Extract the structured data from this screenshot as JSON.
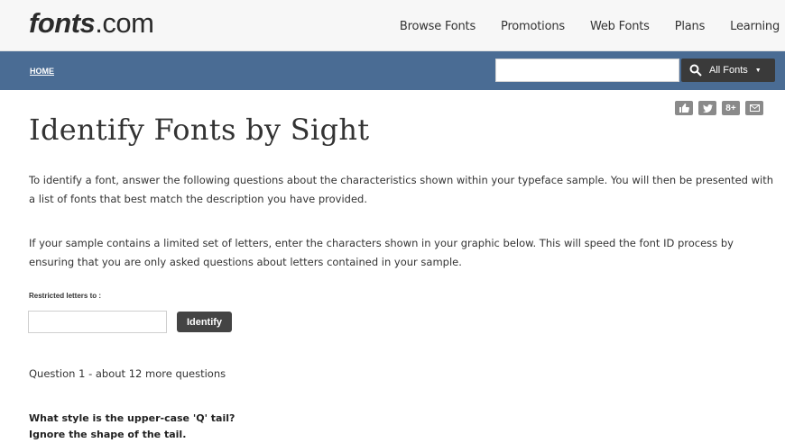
{
  "header": {
    "logo_main": "fonts",
    "logo_rest": ".com",
    "nav": [
      "Browse Fonts",
      "Promotions",
      "Web Fonts",
      "Plans",
      "Learning"
    ]
  },
  "subbar": {
    "breadcrumb": "HOME",
    "search_value": "",
    "search_scope": "All Fonts"
  },
  "share": {
    "icons": [
      "thumbs-up-icon",
      "twitter-icon",
      "google-plus-icon",
      "mail-icon"
    ],
    "google_label": "8+"
  },
  "main": {
    "title": "Identify Fonts by Sight",
    "intro": "To identify a font, answer the following questions about the characteristics shown within your typeface sample. You will then be presented with a list of fonts that best match the description you have provided.",
    "restrict_info": "If your sample contains a limited set of letters, enter the characters shown in your graphic below. This will speed the font ID process by ensuring that you are only asked questions about letters contained in your sample.",
    "restrict_label": "Restricted letters to :",
    "restrict_value": "",
    "identify_label": "Identify",
    "question_count": "Question 1 - about 12 more questions",
    "question_line1": "What style is the upper-case 'Q' tail?",
    "question_line2": "Ignore the shape of the tail."
  },
  "colors": {
    "bluebar": "#4a6c94",
    "dark_button": "#444444"
  }
}
